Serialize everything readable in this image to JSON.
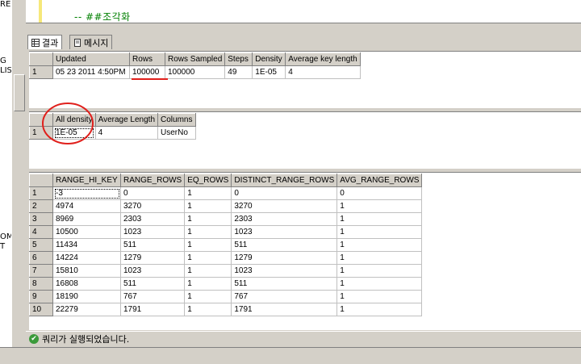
{
  "left_fragments": [
    "REI",
    "G",
    "LIS",
    "OM",
    "T"
  ],
  "editor": {
    "code_line": "-- ##조각화"
  },
  "tabs": [
    {
      "label": "결과",
      "icon": "grid-icon"
    },
    {
      "label": "메시지",
      "icon": "message-icon"
    }
  ],
  "header_grid": {
    "columns": [
      "Updated",
      "Rows",
      "Rows Sampled",
      "Steps",
      "Density",
      "Average key length"
    ],
    "rows": [
      [
        "05 23 2011  4:50PM",
        "100000",
        "100000",
        "49",
        "1E-05",
        "4"
      ]
    ]
  },
  "density_grid": {
    "columns": [
      "All density",
      "Average Length",
      "Columns"
    ],
    "rows": [
      [
        "1E-05",
        "4",
        "UserNo"
      ]
    ]
  },
  "histogram_grid": {
    "columns": [
      "RANGE_HI_KEY",
      "RANGE_ROWS",
      "EQ_ROWS",
      "DISTINCT_RANGE_ROWS",
      "AVG_RANGE_ROWS"
    ],
    "rows": [
      [
        "-3",
        "0",
        "1",
        "0",
        "0"
      ],
      [
        "4974",
        "3270",
        "1",
        "3270",
        "1"
      ],
      [
        "8969",
        "2303",
        "1",
        "2303",
        "1"
      ],
      [
        "10500",
        "1023",
        "1",
        "1023",
        "1"
      ],
      [
        "11434",
        "511",
        "1",
        "511",
        "1"
      ],
      [
        "14224",
        "1279",
        "1",
        "1279",
        "1"
      ],
      [
        "15810",
        "1023",
        "1",
        "1023",
        "1"
      ],
      [
        "16808",
        "511",
        "1",
        "511",
        "1"
      ],
      [
        "18190",
        "767",
        "1",
        "767",
        "1"
      ],
      [
        "22279",
        "1791",
        "1",
        "1791",
        "1"
      ]
    ]
  },
  "status": {
    "message": "쿼리가 실행되었습니다.",
    "icon": "check-icon"
  },
  "annotation_color": "#e0201c"
}
